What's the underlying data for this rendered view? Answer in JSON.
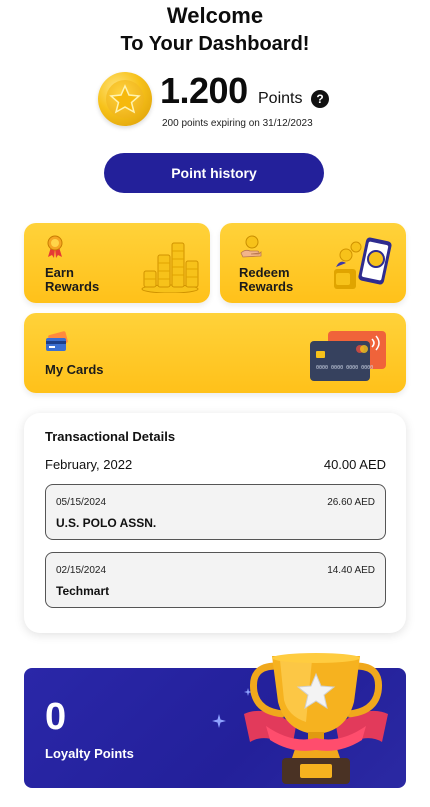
{
  "header": {
    "line1": "Welcome",
    "line2": "To Your Dashboard!"
  },
  "points": {
    "value": "1.200",
    "label": "Points",
    "help": "?",
    "expiry_note": "200 points expiring on 31/12/2023"
  },
  "history_button": "Point history",
  "tiles": {
    "earn": {
      "line1": "Earn",
      "line2": "Rewards"
    },
    "redeem": {
      "line1": "Redeem",
      "line2": "Rewards"
    },
    "my_cards": {
      "label": "My Cards"
    }
  },
  "transactions": {
    "title": "Transactional Details",
    "month": "February, 2022",
    "month_total": "40.00 AED",
    "items": [
      {
        "date": "05/15/2024",
        "amount": "26.60 AED",
        "merchant": "U.S. POLO ASSN."
      },
      {
        "date": "02/15/2024",
        "amount": "14.40 AED",
        "merchant": "Techmart"
      }
    ]
  },
  "loyalty": {
    "value": "0",
    "label": "Loyalty Points"
  },
  "colors": {
    "primary": "#23209a",
    "accent": "#ffc11a"
  }
}
